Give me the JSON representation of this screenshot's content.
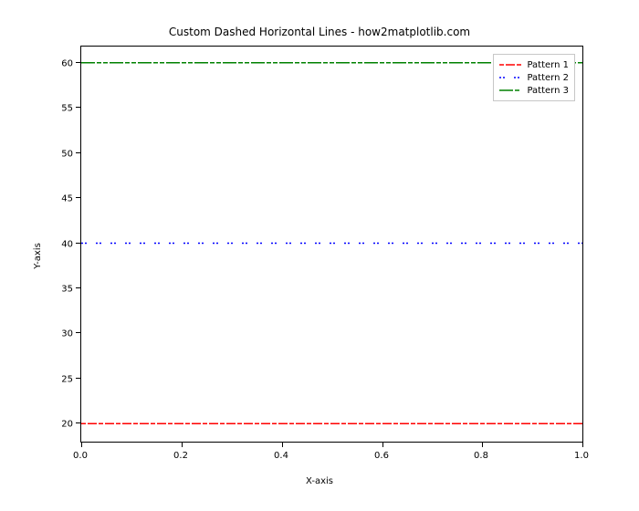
{
  "chart_data": {
    "type": "line",
    "title": "Custom Dashed Horizontal Lines - how2matplotlib.com",
    "xlabel": "X-axis",
    "ylabel": "Y-axis",
    "xlim": [
      0.0,
      1.0
    ],
    "ylim": [
      18,
      62
    ],
    "xticks": [
      0.0,
      0.2,
      0.4,
      0.6,
      0.8,
      1.0
    ],
    "yticks": [
      20,
      25,
      30,
      35,
      40,
      45,
      50,
      55,
      60
    ],
    "x": [
      0.0,
      1.0
    ],
    "series": [
      {
        "name": "Pattern 1",
        "values": [
          20,
          20
        ],
        "color": "#ff0000",
        "dash": "5,2,10,2"
      },
      {
        "name": "Pattern 2",
        "values": [
          40,
          40
        ],
        "color": "#0000ff",
        "dash": "2,2,2,10"
      },
      {
        "name": "Pattern 3",
        "values": [
          60,
          60
        ],
        "color": "#008000",
        "dash": "15,2,5,2,5"
      }
    ],
    "legend": {
      "position": "upper right",
      "entries": [
        "Pattern 1",
        "Pattern 2",
        "Pattern 3"
      ]
    }
  },
  "ticks_x_labels": [
    "0.0",
    "0.2",
    "0.4",
    "0.6",
    "0.8",
    "1.0"
  ],
  "ticks_y_labels": [
    "20",
    "25",
    "30",
    "35",
    "40",
    "45",
    "50",
    "55",
    "60"
  ]
}
